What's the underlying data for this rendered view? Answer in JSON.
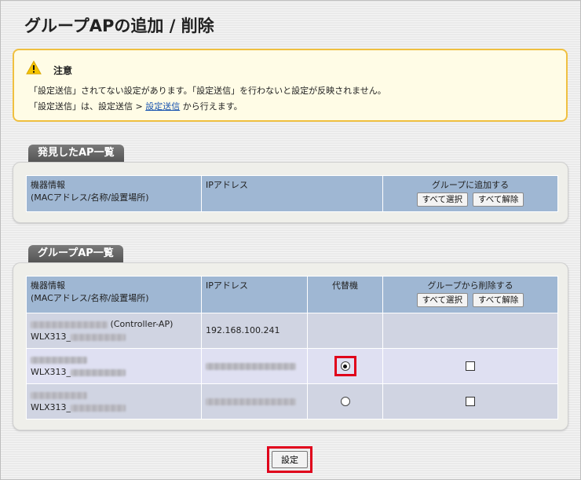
{
  "page": {
    "title": "グループAPの追加 / 削除"
  },
  "notice": {
    "title": "注意",
    "line1": "「設定送信」されてない設定があります。「設定送信」を行わないと設定が反映されません。",
    "line2_prefix": "「設定送信」は、設定送信 > ",
    "line2_link": "設定送信",
    "line2_suffix": " から行えます。",
    "accent_color": "#f0c040"
  },
  "discovered": {
    "tab_label": "発見したAP一覧",
    "col_device_line1": "機器情報",
    "col_device_line2": "(MACアドレス/名称/設置場所)",
    "col_ip": "IPアドレス",
    "col_add": "グループに追加する",
    "select_all": "すべて選択",
    "deselect_all": "すべて解除"
  },
  "group": {
    "tab_label": "グループAP一覧",
    "col_device_line1": "機器情報",
    "col_device_line2": "(MACアドレス/名称/設置場所)",
    "col_ip": "IPアドレス",
    "col_alt": "代替機",
    "col_remove": "グループから削除する",
    "select_all": "すべて選択",
    "deselect_all": "すべて解除",
    "rows": [
      {
        "role": "(Controller-AP)",
        "name_prefix": "WLX313_",
        "ip": "192.168.100.241",
        "alt_selected": false,
        "has_controls": false
      },
      {
        "role": "",
        "name_prefix": "WLX313_",
        "ip": "",
        "alt_selected": true,
        "has_controls": true
      },
      {
        "role": "",
        "name_prefix": "WLX313_",
        "ip": "",
        "alt_selected": false,
        "has_controls": true
      }
    ]
  },
  "submit": {
    "label": "設定"
  },
  "colors": {
    "header_bg": "#9fb7d3",
    "row_bg": "#d0d4e2",
    "highlight": "#e0001b"
  }
}
